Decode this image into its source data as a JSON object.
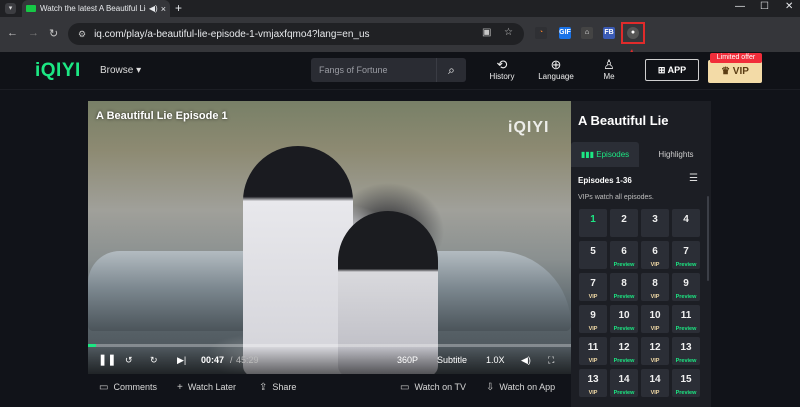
{
  "browser": {
    "tab_title": "Watch the latest A Beautiful Lie",
    "tab_audio_icon": "speaker-icon",
    "tab_close": "×",
    "new_tab": "+",
    "url": "iq.com/play/a-beautiful-lie-episode-1-vmjaxfqmo4?lang=en_us",
    "window_controls": [
      "—",
      "☐",
      "✕"
    ],
    "extensions": [
      {
        "name": "extension-1",
        "label": "◔",
        "color": "#e87b2b",
        "bg": "#2f3034"
      },
      {
        "name": "extension-2",
        "label": "GIF",
        "color": "#ffffff",
        "bg": "#1a73e8"
      },
      {
        "name": "extension-3",
        "label": "⌂",
        "color": "#ffffff",
        "bg": "#444"
      },
      {
        "name": "extension-4",
        "label": "FB",
        "color": "#ffffff",
        "bg": "#3b5bb5"
      },
      {
        "name": "extension-5",
        "label": "●",
        "color": "#ffffff",
        "bg": "#555"
      }
    ]
  },
  "site": {
    "logo": "iQIYI",
    "browse": "Browse ▾",
    "search_placeholder": "Fangs of Fortune",
    "nav": [
      {
        "icon": "⟲",
        "label": "History"
      },
      {
        "icon": "⊕",
        "label": "Language"
      },
      {
        "icon": "♙",
        "label": "Me"
      }
    ],
    "app_button": "⊞ APP",
    "vip_button": "♛ VIP",
    "limited_offer": "Limited offer"
  },
  "player": {
    "title": "A Beautiful Lie Episode 1",
    "watermark": "iQIYI",
    "progress": 0.0173,
    "time_current": "00:47",
    "time_total": "45:29",
    "quality": "360P",
    "subtitle": "Subtitle",
    "speed": "1.0X"
  },
  "actions": [
    {
      "icon": "▭",
      "label": "Comments"
    },
    {
      "icon": "+",
      "label": "Watch Later"
    },
    {
      "icon": "⇪",
      "label": "Share"
    },
    {
      "icon": "▭",
      "label": "Watch on TV"
    },
    {
      "icon": "⇩",
      "label": "Watch on App"
    }
  ],
  "panel": {
    "show_title": "A Beautiful Lie",
    "tab_episodes": "Episodes",
    "tab_highlights": "Highlights",
    "range": "Episodes 1-36",
    "note": "VIPs watch all episodes.",
    "episodes": [
      {
        "n": "1",
        "badge": ""
      },
      {
        "n": "2",
        "badge": ""
      },
      {
        "n": "3",
        "badge": ""
      },
      {
        "n": "4",
        "badge": ""
      },
      {
        "n": "5",
        "badge": ""
      },
      {
        "n": "6",
        "badge": "Preview"
      },
      {
        "n": "6",
        "badge": "VIP"
      },
      {
        "n": "7",
        "badge": "Preview"
      },
      {
        "n": "7",
        "badge": "VIP"
      },
      {
        "n": "8",
        "badge": "Preview"
      },
      {
        "n": "8",
        "badge": "VIP"
      },
      {
        "n": "9",
        "badge": "Preview"
      },
      {
        "n": "9",
        "badge": "VIP"
      },
      {
        "n": "10",
        "badge": "Preview"
      },
      {
        "n": "10",
        "badge": "VIP"
      },
      {
        "n": "11",
        "badge": "Preview"
      },
      {
        "n": "11",
        "badge": "VIP"
      },
      {
        "n": "12",
        "badge": "Preview"
      },
      {
        "n": "12",
        "badge": "VIP"
      },
      {
        "n": "13",
        "badge": "Preview"
      },
      {
        "n": "13",
        "badge": "VIP"
      },
      {
        "n": "14",
        "badge": "Preview"
      },
      {
        "n": "14",
        "badge": "VIP"
      },
      {
        "n": "15",
        "badge": "Preview"
      }
    ]
  }
}
